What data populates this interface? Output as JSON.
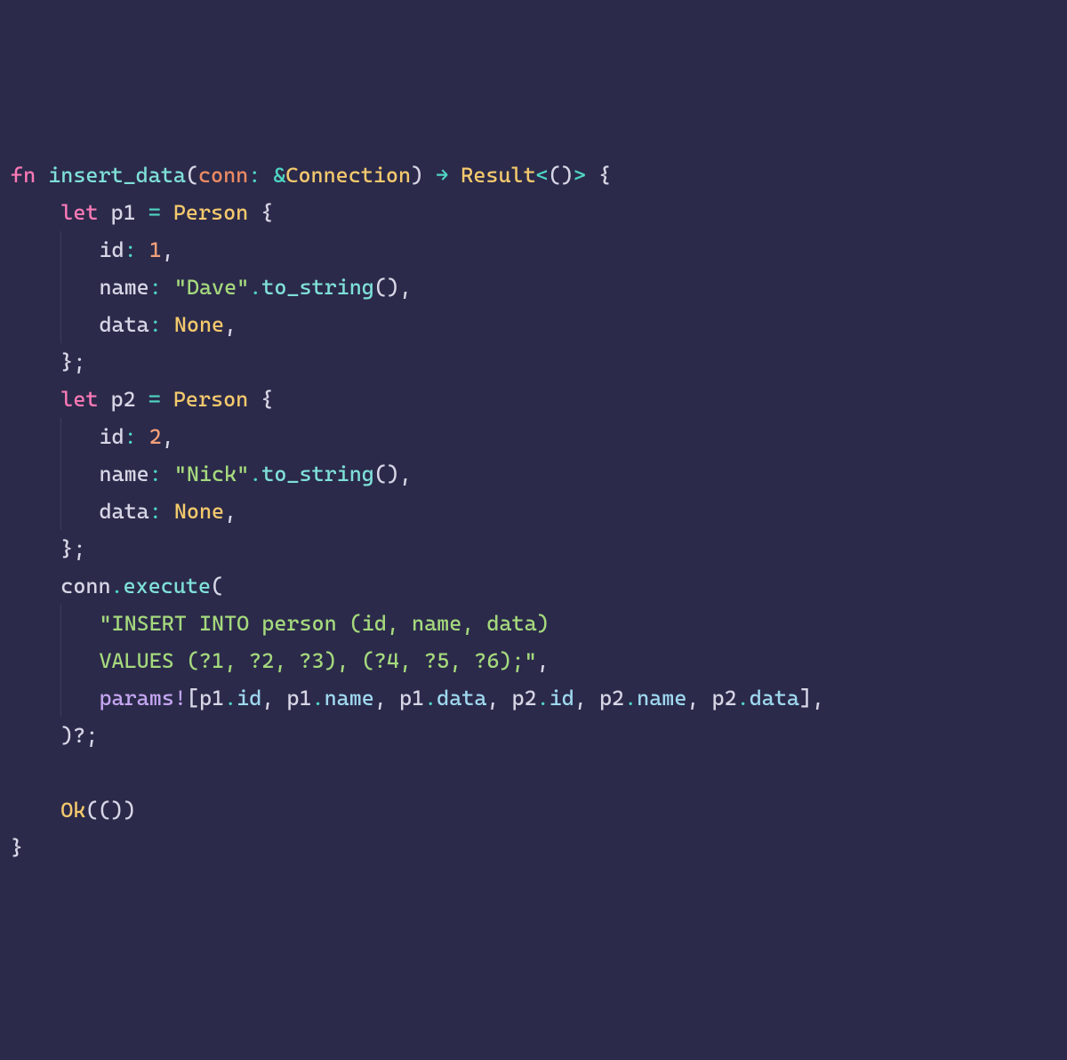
{
  "lines": {
    "l1": {
      "kw_fn": "fn",
      "fn_name": "insert_data",
      "open": "(",
      "param": "conn",
      "colon": ": ",
      "amp": "&",
      "type": "Connection",
      "close": ")",
      "arrow": " → ",
      "ret": "Result",
      "lt": "<",
      "unit": "()",
      "gt": ">",
      "brace": " {"
    },
    "l2": {
      "kw_let": "let",
      "var": " p1 ",
      "eq": "= ",
      "type": "Person",
      "brace": " {"
    },
    "l3": {
      "field": "id",
      "colon": ": ",
      "val": "1",
      "comma": ","
    },
    "l4": {
      "field": "name",
      "colon": ": ",
      "str": "\"Dave\"",
      "dot": ".",
      "method": "to_string",
      "call": "(),",
      "end": ""
    },
    "l5": {
      "field": "data",
      "colon": ": ",
      "val": "None",
      "comma": ","
    },
    "l6": {
      "close": "};"
    },
    "l7": {
      "kw_let": "let",
      "var": " p2 ",
      "eq": "= ",
      "type": "Person",
      "brace": " {"
    },
    "l8": {
      "field": "id",
      "colon": ": ",
      "val": "2",
      "comma": ","
    },
    "l9": {
      "field": "name",
      "colon": ": ",
      "str": "\"Nick\"",
      "dot": ".",
      "method": "to_string",
      "call": "(),",
      "end": ""
    },
    "l10": {
      "field": "data",
      "colon": ": ",
      "val": "None",
      "comma": ","
    },
    "l11": {
      "close": "};"
    },
    "l12": {
      "obj": "conn",
      "dot": ".",
      "method": "execute",
      "open": "("
    },
    "l13": {
      "str": "\"INSERT INTO person (id, name, data)"
    },
    "l14": {
      "str": "VALUES (?1, ?2, ?3), (?4, ?5, ?6);\"",
      "comma": ","
    },
    "l15": {
      "macro": "params!",
      "open": "[",
      "p1": "p1",
      "d1": ".",
      "f1": "id",
      "c1": ", ",
      "p2": "p1",
      "d2": ".",
      "f2": "name",
      "c2": ", ",
      "p3": "p1",
      "d3": ".",
      "f3": "data",
      "c3": ", ",
      "p4": "p2",
      "d4": ".",
      "f4": "id",
      "c4": ", ",
      "p5": "p2",
      "d5": ".",
      "f5": "name",
      "c5": ", ",
      "p6": "p2",
      "d6": ".",
      "f6": "data",
      "close": "],"
    },
    "l16": {
      "close": ")?;"
    },
    "l17": {
      "blank": ""
    },
    "l18": {
      "ok": "Ok",
      "call": "(())"
    },
    "l19": {
      "close": "}"
    }
  }
}
